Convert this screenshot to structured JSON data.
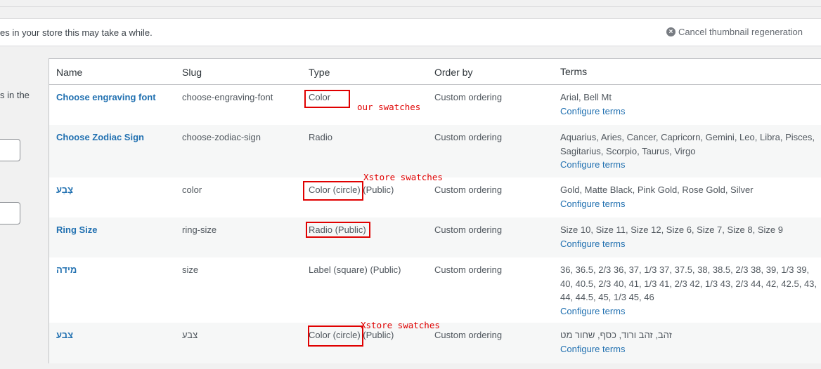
{
  "notice": {
    "text": "es in your store this may take a while.",
    "cancel_label": "Cancel thumbnail regeneration",
    "cancel_icon": "close-circle-icon"
  },
  "left_panel": {
    "hint": "s in the"
  },
  "table": {
    "headers": {
      "name": "Name",
      "slug": "Slug",
      "type": "Type",
      "order_by": "Order by",
      "terms": "Terms"
    },
    "configure_label": "Configure terms",
    "rows": [
      {
        "name": "Choose engraving font",
        "slug": "choose-engraving-font",
        "type": "Color",
        "order_by": "Custom ordering",
        "terms": "Arial, Bell Mt"
      },
      {
        "name": "Choose Zodiac Sign",
        "slug": "choose-zodiac-sign",
        "type": "Radio",
        "order_by": "Custom ordering",
        "terms": "Aquarius, Aries, Cancer, Capricorn, Gemini, Leo, Libra, Pisces, Sagitarius, Scorpio, Taurus, Virgo"
      },
      {
        "name": "צֶבַע",
        "slug": "color",
        "type": "Color (circle) (Public)",
        "order_by": "Custom ordering",
        "terms": "Gold, Matte Black, Pink Gold, Rose Gold, Silver"
      },
      {
        "name": "Ring Size",
        "slug": "ring-size",
        "type": "Radio (Public)",
        "order_by": "Custom ordering",
        "terms": "Size 10, Size 11, Size 12, Size 6, Size 7, Size 8, Size 9"
      },
      {
        "name": "מידה",
        "slug": "size",
        "type": "Label (square) (Public)",
        "order_by": "Custom ordering",
        "terms": "36, 36.5, 2/3 36, 37, 1/3 37, 37.5, 38, 38.5, 2/3 38, 39, 1/3 39, 40, 40.5, 2/3 40, 41, 1/3 41, 2/3 42, 1/3 43, 2/3 44, 42, 42.5, 43, 44, 44.5, 45, 1/3 45, 46"
      },
      {
        "name": "צבע",
        "slug": "צבע",
        "type": "Color (circle) (Public)",
        "order_by": "Custom ordering",
        "terms": "זהב, זהב ורוד, כסף, שחור מט"
      }
    ]
  },
  "annotations": {
    "our_swatches": "our swatches",
    "xstore_1": "Xstore swatches",
    "xstore_2": "Xstore swatches",
    "highlight_color": "#e00000"
  }
}
